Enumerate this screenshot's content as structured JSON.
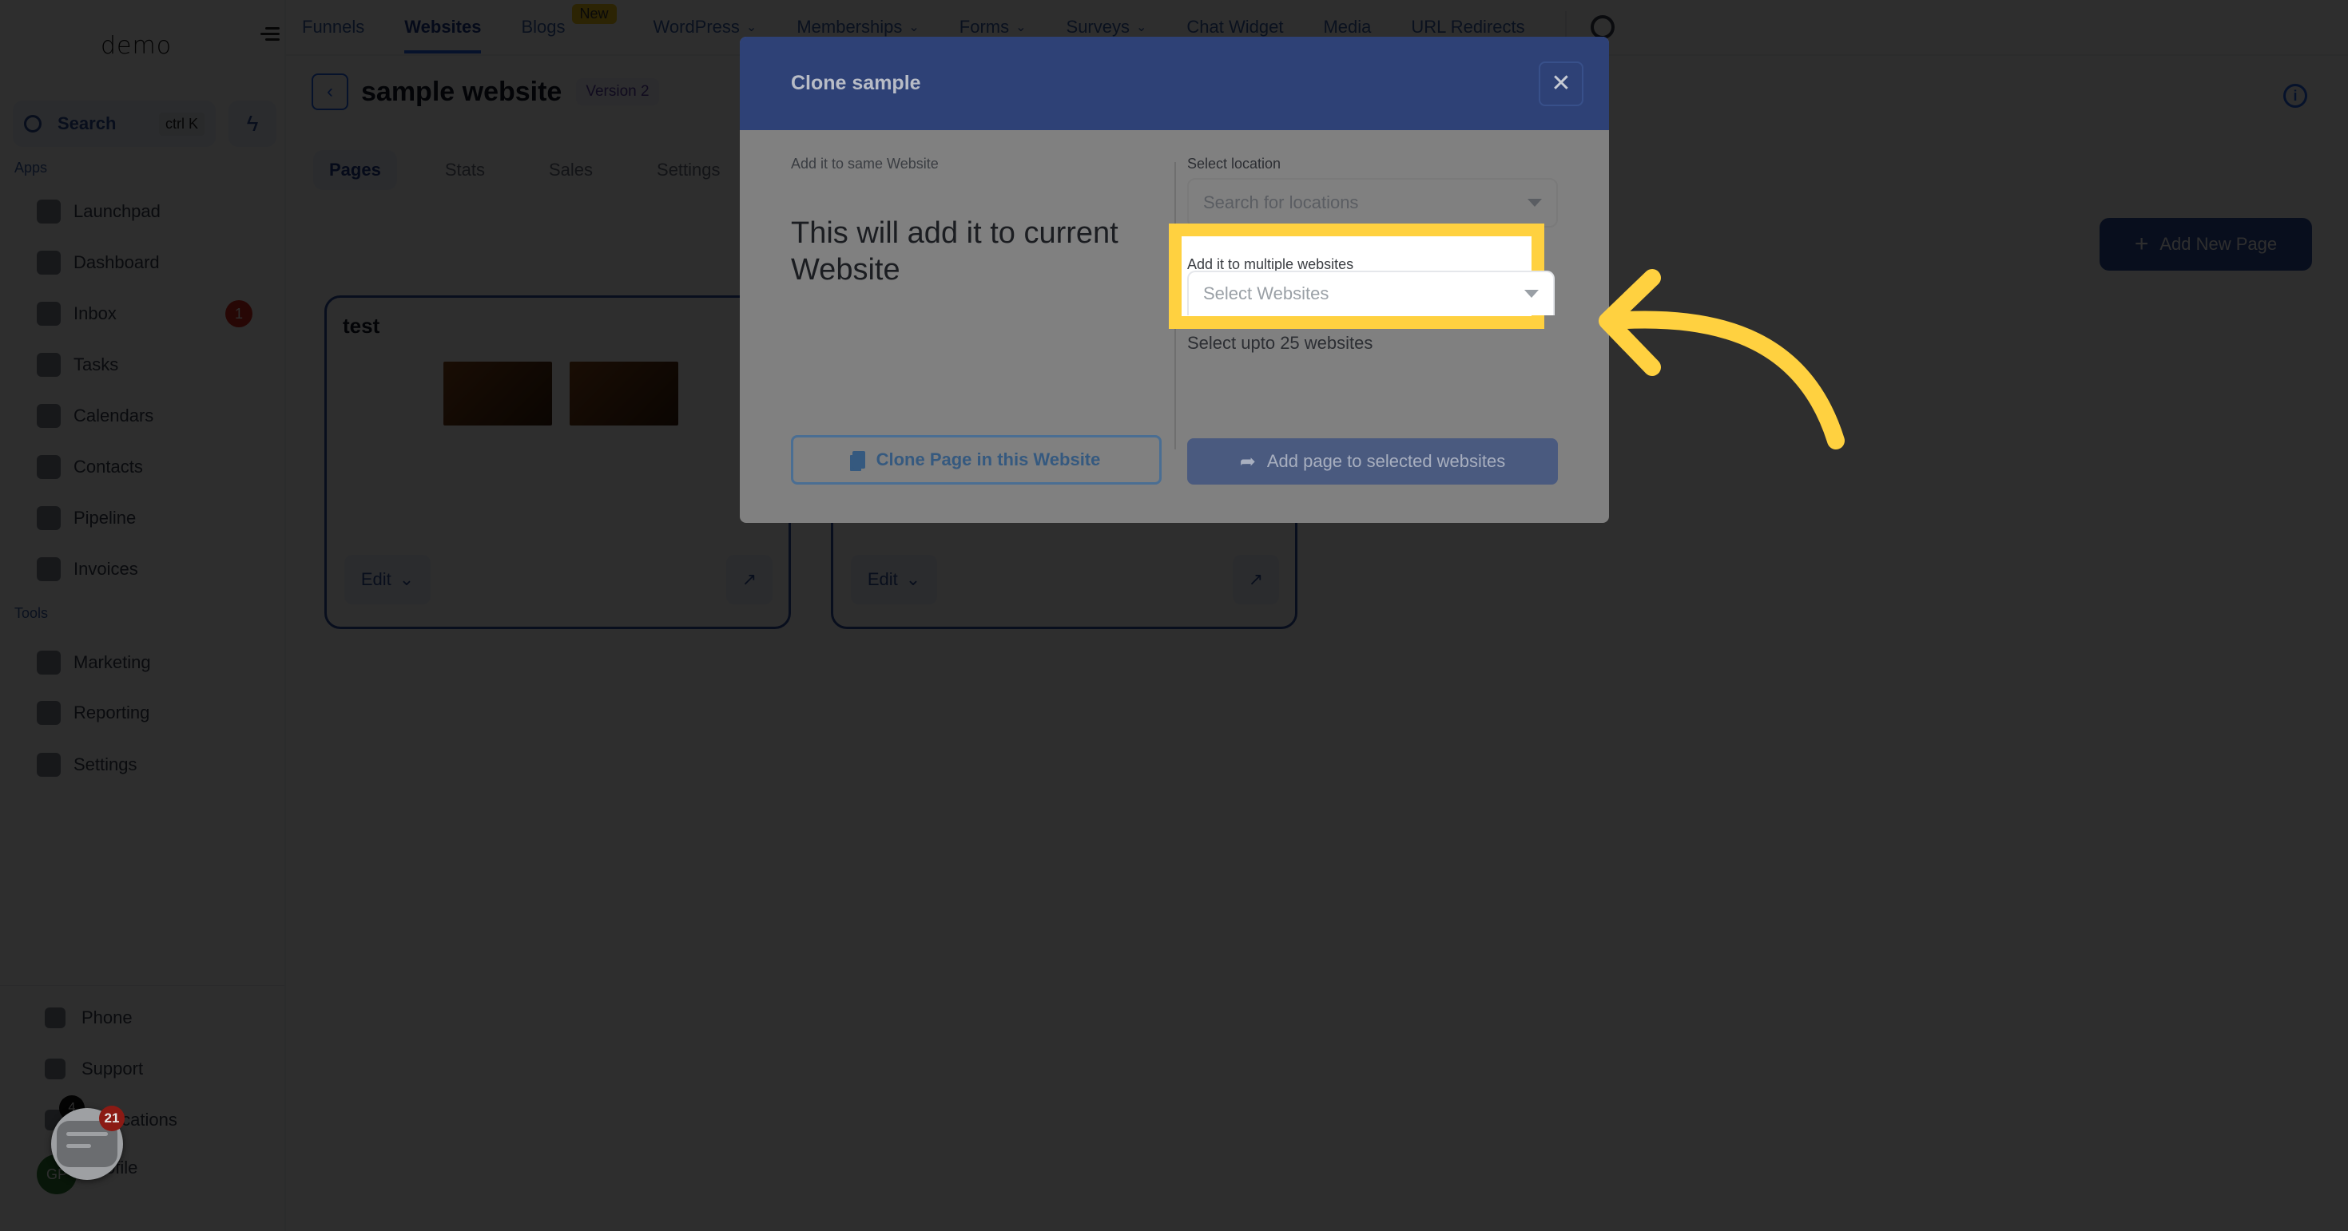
{
  "sidebar": {
    "logo": "demo",
    "search": {
      "placeholder": "Search",
      "shortcut": "ctrl K"
    },
    "apps_label": "Apps",
    "tools_label": "Tools",
    "apps": [
      {
        "label": "Launchpad",
        "icon": "launchpad-icon"
      },
      {
        "label": "Dashboard",
        "icon": "dashboard-icon"
      },
      {
        "label": "Inbox",
        "icon": "inbox-icon",
        "badge": "1"
      },
      {
        "label": "Tasks",
        "icon": "tasks-icon"
      },
      {
        "label": "Calendars",
        "icon": "calendar-icon"
      },
      {
        "label": "Contacts",
        "icon": "contacts-icon"
      },
      {
        "label": "Pipeline",
        "icon": "pipeline-icon"
      },
      {
        "label": "Invoices",
        "icon": "invoices-icon"
      }
    ],
    "tools": [
      {
        "label": "Marketing",
        "icon": "megaphone-icon"
      },
      {
        "label": "Reporting",
        "icon": "pie-chart-icon"
      },
      {
        "label": "Settings",
        "icon": "gear-icon"
      }
    ],
    "bottom": [
      {
        "label": "Phone",
        "icon": "phone-icon"
      },
      {
        "label": "Support",
        "icon": "support-icon"
      },
      {
        "label": "Notifications",
        "icon": "bell-icon",
        "badge": "4"
      },
      {
        "label": "Profile",
        "icon": "avatar",
        "initials": "GP"
      }
    ]
  },
  "topnav": {
    "items": [
      {
        "label": "Funnels"
      },
      {
        "label": "Websites",
        "active": true
      },
      {
        "label": "Blogs",
        "badge": "New"
      },
      {
        "label": "WordPress",
        "dropdown": true
      },
      {
        "label": "Memberships",
        "dropdown": true
      },
      {
        "label": "Forms",
        "dropdown": true
      },
      {
        "label": "Surveys",
        "dropdown": true
      },
      {
        "label": "Chat Widget"
      },
      {
        "label": "Media"
      },
      {
        "label": "URL Redirects"
      }
    ]
  },
  "page": {
    "title": "sample website",
    "version": "Version 2",
    "tabs": [
      "Pages",
      "Stats",
      "Sales",
      "Settings"
    ],
    "active_tab": "Pages",
    "add_button": "Add New Page",
    "cards": [
      {
        "title": "test",
        "edit_label": "Edit"
      },
      {
        "title": "",
        "edit_label": "Edit"
      }
    ]
  },
  "modal": {
    "title": "Clone sample",
    "close_label": "✕",
    "left": {
      "label": "Add it to same Website",
      "description": "This will add it to current Website",
      "button": "Clone Page in this Website"
    },
    "right": {
      "location_label": "Select location",
      "location_placeholder": "Search for locations",
      "websites_label": "Add it to multiple websites",
      "websites_placeholder": "Select Websites",
      "hint": "Select upto 25 websites",
      "button": "Add page to selected websites"
    }
  },
  "chat_widget": {
    "badge": "21"
  },
  "colors": {
    "modal_header": "#2e4176",
    "highlight": "#ffd140",
    "primary": "#2c4da0"
  }
}
